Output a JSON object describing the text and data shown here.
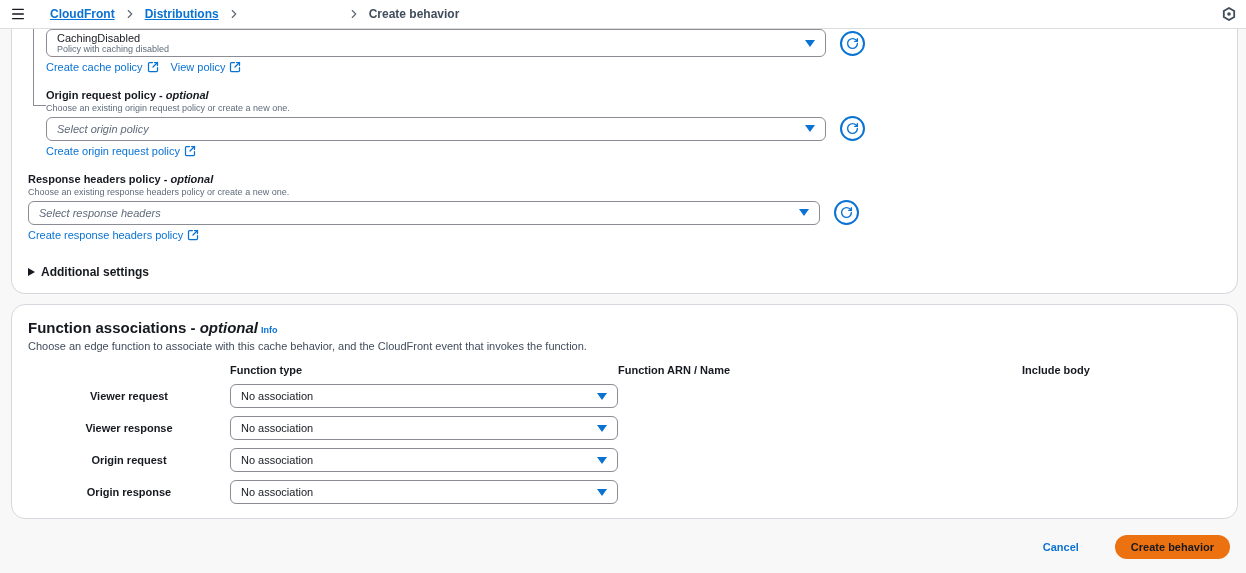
{
  "header": {
    "breadcrumbs": [
      {
        "label": "CloudFront"
      },
      {
        "label": "Distributions"
      }
    ],
    "current": "Create behavior"
  },
  "cache_policy": {
    "value": "CachingDisabled",
    "description": "Policy with caching disabled",
    "links": [
      "Create cache policy",
      "View policy"
    ]
  },
  "origin_request_policy": {
    "label": "Origin request policy - *optional*",
    "description": "Choose an existing origin request policy or create a new one.",
    "placeholder": "Select origin policy",
    "links": [
      "Create origin request policy"
    ]
  },
  "response_headers_policy": {
    "label": "Response headers policy - *optional*",
    "description": "Choose an existing response headers policy or create a new one.",
    "placeholder": "Select response headers",
    "links": [
      "Create response headers policy"
    ]
  },
  "additional_settings": {
    "label": "Additional settings",
    "expanded": false
  },
  "function_associations": {
    "title": "Function associations - *optional*",
    "info": "Info",
    "description": "Choose an edge function to associate with this cache behavior, and the CloudFront event that invokes the function.",
    "columns": [
      "Function type",
      "Function ARN / Name",
      "Include body"
    ],
    "rows": [
      {
        "event": "Viewer request",
        "function_type": "No association"
      },
      {
        "event": "Viewer response",
        "function_type": "No association"
      },
      {
        "event": "Origin request",
        "function_type": "No association"
      },
      {
        "event": "Origin response",
        "function_type": "No association"
      }
    ]
  },
  "footer": {
    "cancel": "Cancel",
    "submit": "Create behavior"
  }
}
